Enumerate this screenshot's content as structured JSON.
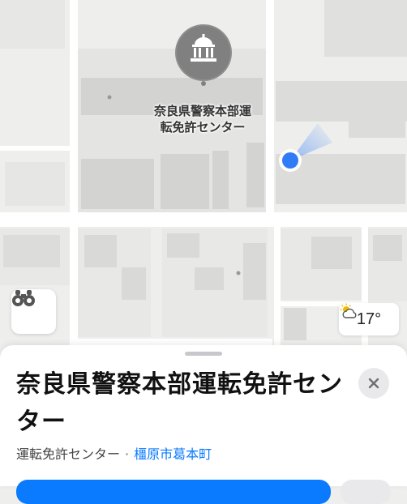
{
  "map": {
    "poi_label": "奈良県警察本部運\n転免許センター",
    "poi_icon": "government-building-icon",
    "user_location_icon": "user-location-dot"
  },
  "controls": {
    "look_around_icon": "binoculars-icon"
  },
  "weather": {
    "icon": "partly-sunny-icon",
    "temperature": "17°"
  },
  "sheet": {
    "title": "奈良県警察本部運転免許センター",
    "category": "運転免許センター",
    "separator": "·",
    "location": "橿原市葛本町",
    "close_icon": "close-icon"
  }
}
